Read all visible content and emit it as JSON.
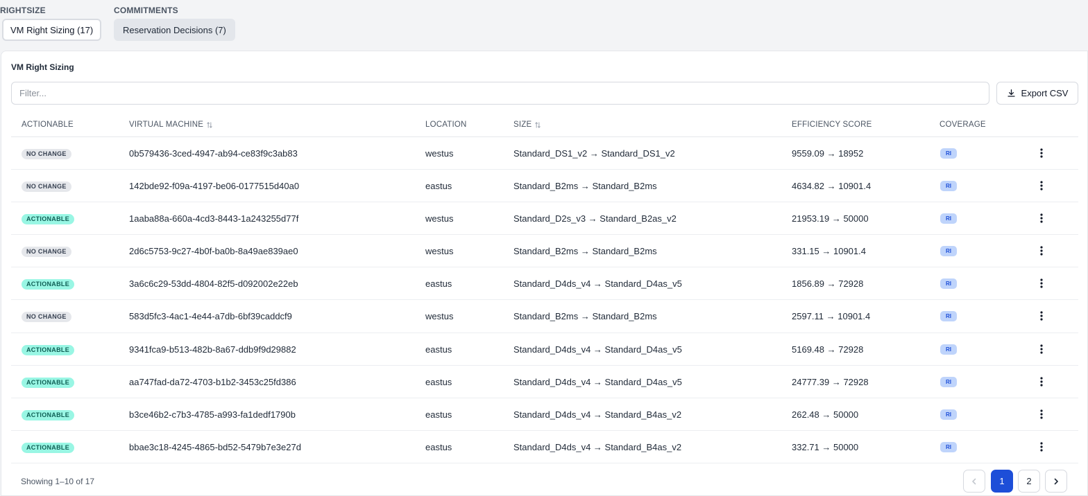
{
  "groups": [
    {
      "label": "RIGHTSIZE",
      "tab": "VM Right Sizing (17)"
    },
    {
      "label": "COMMITMENTS",
      "tab": "Reservation Decisions (7)"
    }
  ],
  "card": {
    "title": "VM Right Sizing",
    "filter_placeholder": "Filter...",
    "export_label": "Export CSV"
  },
  "columns": {
    "actionable": "ACTIONABLE",
    "vm": "VIRTUAL MACHINE",
    "location": "LOCATION",
    "size": "SIZE",
    "efficiency": "EFFICIENCY SCORE",
    "coverage": "COVERAGE"
  },
  "rows": [
    {
      "status": "NO CHANGE",
      "vm": "0b579436-3ced-4947-ab94-ce83f9c3ab83",
      "location": "westus",
      "size": "Standard_DS1_v2 → Standard_DS1_v2",
      "efficiency": "9559.09 → 18952",
      "coverage": "RI"
    },
    {
      "status": "NO CHANGE",
      "vm": "142bde92-f09a-4197-be06-0177515d40a0",
      "location": "eastus",
      "size": "Standard_B2ms → Standard_B2ms",
      "efficiency": "4634.82 → 10901.4",
      "coverage": "RI"
    },
    {
      "status": "ACTIONABLE",
      "vm": "1aaba88a-660a-4cd3-8443-1a243255d77f",
      "location": "westus",
      "size": "Standard_D2s_v3 → Standard_B2as_v2",
      "efficiency": "21953.19 → 50000",
      "coverage": "RI"
    },
    {
      "status": "NO CHANGE",
      "vm": "2d6c5753-9c27-4b0f-ba0b-8a49ae839ae0",
      "location": "westus",
      "size": "Standard_B2ms → Standard_B2ms",
      "efficiency": "331.15 → 10901.4",
      "coverage": "RI"
    },
    {
      "status": "ACTIONABLE",
      "vm": "3a6c6c29-53dd-4804-82f5-d092002e22eb",
      "location": "eastus",
      "size": "Standard_D4ds_v4 → Standard_D4as_v5",
      "efficiency": "1856.89 → 72928",
      "coverage": "RI"
    },
    {
      "status": "NO CHANGE",
      "vm": "583d5fc3-4ac1-4e44-a7db-6bf39caddcf9",
      "location": "westus",
      "size": "Standard_B2ms → Standard_B2ms",
      "efficiency": "2597.11 → 10901.4",
      "coverage": "RI"
    },
    {
      "status": "ACTIONABLE",
      "vm": "9341fca9-b513-482b-8a67-ddb9f9d29882",
      "location": "eastus",
      "size": "Standard_D4ds_v4 → Standard_D4as_v5",
      "efficiency": "5169.48 → 72928",
      "coverage": "RI"
    },
    {
      "status": "ACTIONABLE",
      "vm": "aa747fad-da72-4703-b1b2-3453c25fd386",
      "location": "eastus",
      "size": "Standard_D4ds_v4 → Standard_D4as_v5",
      "efficiency": "24777.39 → 72928",
      "coverage": "RI"
    },
    {
      "status": "ACTIONABLE",
      "vm": "b3ce46b2-c7b3-4785-a993-fa1dedf1790b",
      "location": "eastus",
      "size": "Standard_D4ds_v4 → Standard_B4as_v2",
      "efficiency": "262.48 → 50000",
      "coverage": "RI"
    },
    {
      "status": "ACTIONABLE",
      "vm": "bbae3c18-4245-4865-bd52-5479b7e3e27d",
      "location": "eastus",
      "size": "Standard_D4ds_v4 → Standard_B4as_v2",
      "efficiency": "332.71 → 50000",
      "coverage": "RI"
    }
  ],
  "footer": {
    "showing": "Showing 1–10 of 17",
    "pages": [
      "1",
      "2"
    ],
    "current_page": "1"
  },
  "colors": {
    "actionable_badge": "#99f6e4",
    "nochange_badge": "#e5e7eb",
    "ri_badge": "#bfd4fb",
    "primary": "#1d4ed8"
  }
}
